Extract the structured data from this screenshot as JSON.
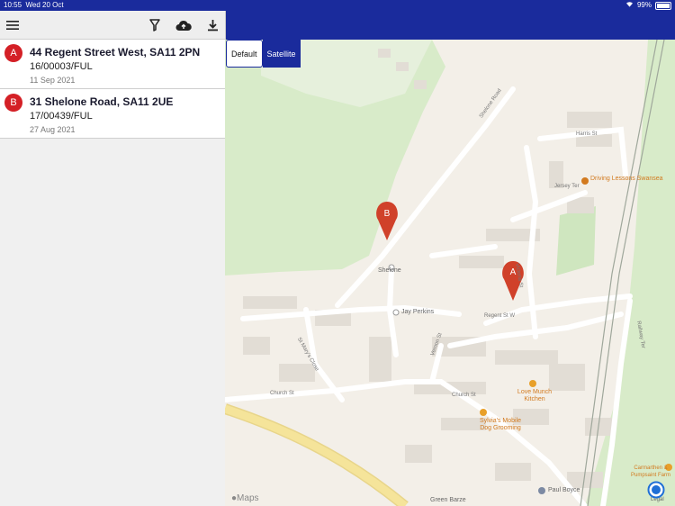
{
  "statusbar": {
    "time": "10:55",
    "date": "Wed 20 Oct",
    "battery": "99%"
  },
  "toolbar": {
    "menu_icon": "hamburger-icon",
    "filter_icon": "filter-icon",
    "upload_icon": "cloud-upload-icon",
    "download_icon": "download-icon"
  },
  "applications": [
    {
      "marker": "A",
      "address": "44 Regent Street West, SA11 2PN",
      "reference": "16/00003/FUL",
      "date": "11 Sep 2021"
    },
    {
      "marker": "B",
      "address": "31 Shelone Road, SA11 2UE",
      "reference": "17/00439/FUL",
      "date": "27 Aug 2021"
    }
  ],
  "map": {
    "toggle": {
      "default_label": "Default",
      "satellite_label": "Satellite",
      "selected": "Default"
    },
    "pins": [
      {
        "label": "A"
      },
      {
        "label": "B"
      }
    ],
    "places": {
      "shelone": "Shelone",
      "jay_perkins": "Jay Perkins",
      "green_barze": "Green Barze",
      "paul_boyce": "Paul Boyce"
    },
    "pois": {
      "driving": "Driving Lessons Swansea",
      "love_munch": "Love Munch Kitchen",
      "sylvias": "Sylvia's Mobile Dog Grooming",
      "carmarthen": "Carmarthen & Pumpsaint Farm"
    },
    "streets": {
      "harris": "Harris St",
      "jersey": "Jersey Ter",
      "regent": "Regent St W",
      "church1": "Church St",
      "church2": "Church St",
      "shelone_rd": "Shelone Road",
      "victoria": "Victoria St",
      "railway": "Railway Ter",
      "vernon": "Vernon St",
      "stmarys": "St Mary's Close"
    },
    "attribution": "Maps",
    "legal": "Legal",
    "colors": {
      "pin": "#d0412a",
      "park": "#d8ebc9",
      "road_major": "#f5e49a",
      "brand_blue": "#1a2b9c",
      "marker_red": "#d42026"
    }
  }
}
